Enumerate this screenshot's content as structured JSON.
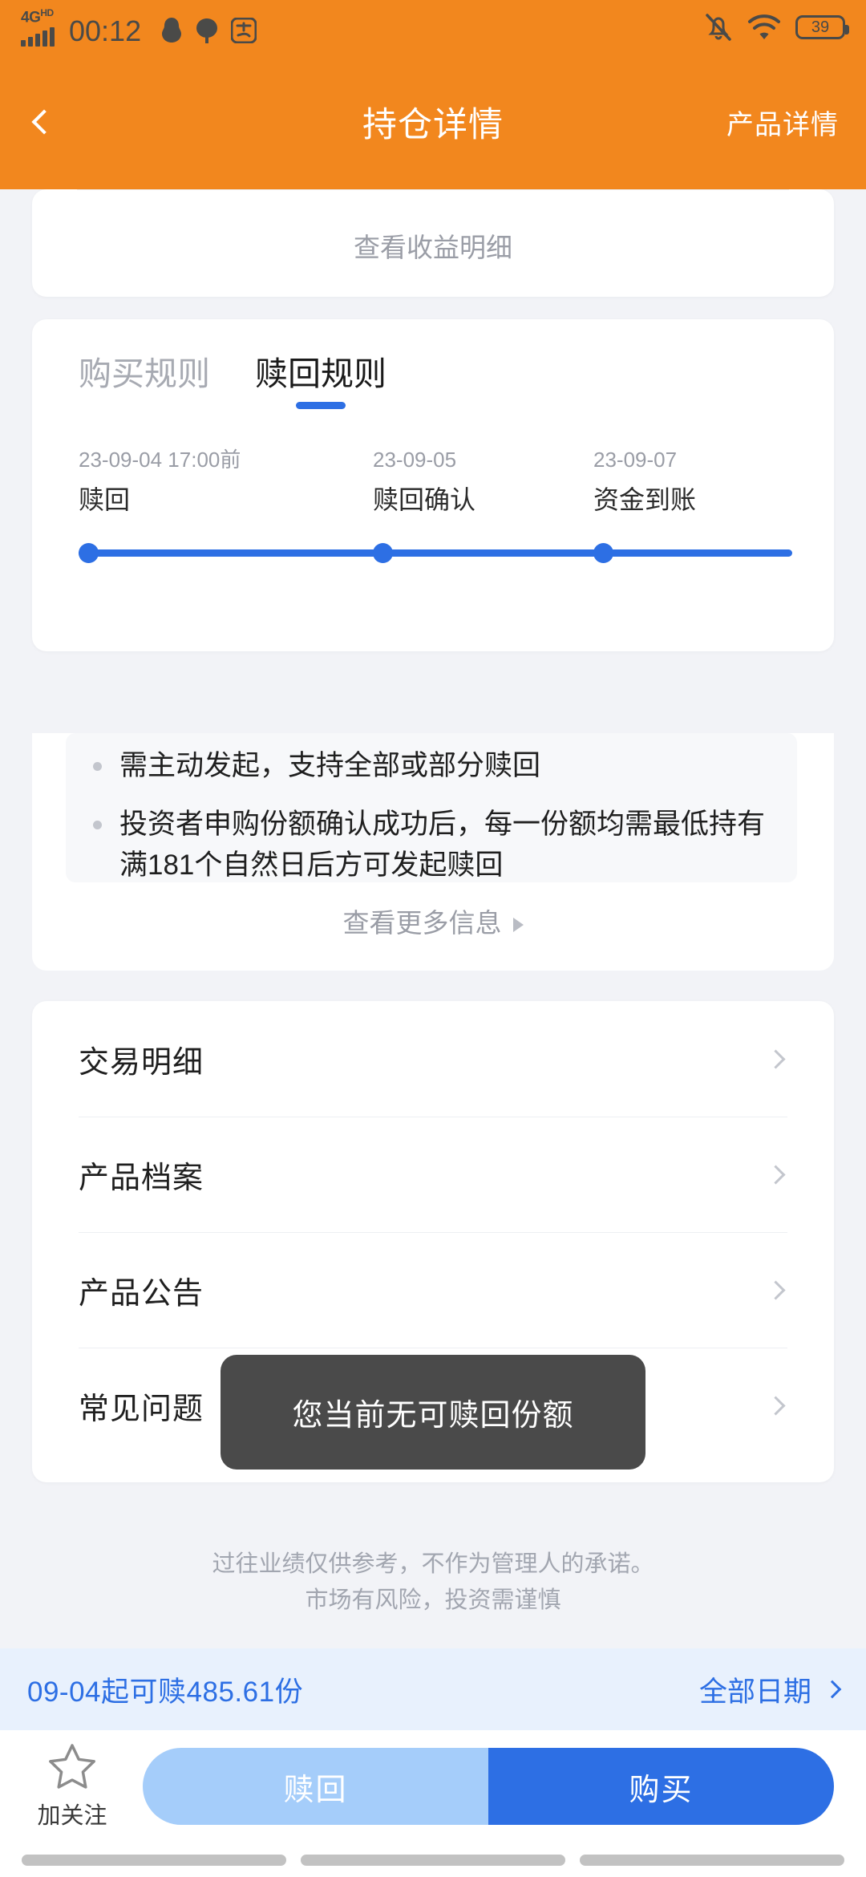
{
  "status_bar": {
    "network_label": "4G",
    "network_sup": "HD",
    "time": "00:12",
    "icons": [
      "qq-penguin-icon",
      "chat-bubble-icon",
      "alipay-icon",
      "bell-muted-icon",
      "wifi-icon"
    ],
    "battery_percent": "39"
  },
  "header": {
    "back_icon": "chevron-left-icon",
    "title": "持仓详情",
    "action_label": "产品详情",
    "background_color": "#F2871E"
  },
  "earnings_card": {
    "link_label": "查看收益明细"
  },
  "rules_card": {
    "tabs": [
      {
        "label": "购买规则",
        "active": false
      },
      {
        "label": "赎回规则",
        "active": true
      }
    ],
    "timeline": [
      {
        "date": "23-09-04 17:00前",
        "name": "赎回"
      },
      {
        "date": "23-09-05",
        "name": "赎回确认"
      },
      {
        "date": "23-09-07",
        "name": "资金到账"
      }
    ],
    "bullets": [
      "需主动发起，支持全部或部分赎回",
      "投资者申购份额确认成功后，每一份额均需最低持有满181个自然日后方可发起赎回"
    ],
    "more_label": "查看更多信息",
    "accent_color": "#2D6FE4"
  },
  "menu": {
    "items": [
      {
        "label": "交易明细"
      },
      {
        "label": "产品档案"
      },
      {
        "label": "产品公告"
      },
      {
        "label": "常见问题"
      }
    ]
  },
  "toast": {
    "message": "您当前无可赎回份额"
  },
  "disclaimer": {
    "line1": "过往业绩仅供参考，不作为管理人的承诺。",
    "line2": "市场有风险，投资需谨慎"
  },
  "notice": {
    "text": "09-04起可赎485.61份",
    "action_label": "全部日期"
  },
  "action_bar": {
    "favorite_label": "加关注",
    "favorite_icon": "star-outline-icon",
    "redeem_label": "赎回",
    "buy_label": "购买",
    "redeem_color": "#A5CDFA",
    "buy_color": "#2D6FE4"
  }
}
